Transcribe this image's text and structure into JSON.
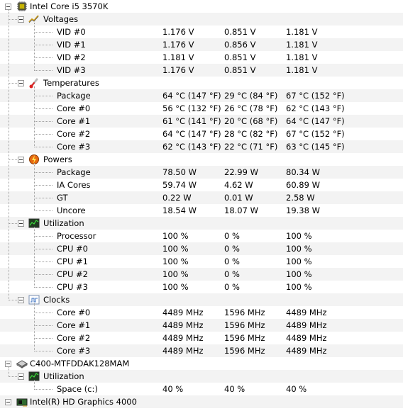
{
  "tree": {
    "cpu": {
      "name": "Intel Core i5 3570K",
      "groups": [
        {
          "title": "Voltages",
          "icon": "voltage-icon",
          "rows": [
            {
              "label": "VID #0",
              "value": "1.176 V",
              "min": "0.851 V",
              "max": "1.181 V"
            },
            {
              "label": "VID #1",
              "value": "1.176 V",
              "min": "0.856 V",
              "max": "1.181 V"
            },
            {
              "label": "VID #2",
              "value": "1.181 V",
              "min": "0.851 V",
              "max": "1.181 V"
            },
            {
              "label": "VID #3",
              "value": "1.176 V",
              "min": "0.851 V",
              "max": "1.181 V"
            }
          ]
        },
        {
          "title": "Temperatures",
          "icon": "thermometer-icon",
          "rows": [
            {
              "label": "Package",
              "value": "64 °C  (147 °F)",
              "min": "29 °C  (84 °F)",
              "max": "67 °C  (152 °F)"
            },
            {
              "label": "Core #0",
              "value": "56 °C  (132 °F)",
              "min": "26 °C  (78 °F)",
              "max": "62 °C  (143 °F)"
            },
            {
              "label": "Core #1",
              "value": "61 °C  (141 °F)",
              "min": "20 °C  (68 °F)",
              "max": "64 °C  (147 °F)"
            },
            {
              "label": "Core #2",
              "value": "64 °C  (147 °F)",
              "min": "28 °C  (82 °F)",
              "max": "67 °C  (152 °F)"
            },
            {
              "label": "Core #3",
              "value": "62 °C  (143 °F)",
              "min": "22 °C  (71 °F)",
              "max": "63 °C  (145 °F)"
            }
          ]
        },
        {
          "title": "Powers",
          "icon": "power-icon",
          "rows": [
            {
              "label": "Package",
              "value": "78.50 W",
              "min": "22.99 W",
              "max": "80.34 W"
            },
            {
              "label": "IA Cores",
              "value": "59.74 W",
              "min": "4.62 W",
              "max": "60.89 W"
            },
            {
              "label": "GT",
              "value": "0.22 W",
              "min": "0.01 W",
              "max": "2.58 W"
            },
            {
              "label": "Uncore",
              "value": "18.54 W",
              "min": "18.07 W",
              "max": "19.38 W"
            }
          ]
        },
        {
          "title": "Utilization",
          "icon": "utilization-icon",
          "rows": [
            {
              "label": "Processor",
              "value": "100 %",
              "min": "0 %",
              "max": "100 %"
            },
            {
              "label": "CPU #0",
              "value": "100 %",
              "min": "0 %",
              "max": "100 %"
            },
            {
              "label": "CPU #1",
              "value": "100 %",
              "min": "0 %",
              "max": "100 %"
            },
            {
              "label": "CPU #2",
              "value": "100 %",
              "min": "0 %",
              "max": "100 %"
            },
            {
              "label": "CPU #3",
              "value": "100 %",
              "min": "0 %",
              "max": "100 %"
            }
          ]
        },
        {
          "title": "Clocks",
          "icon": "clock-icon",
          "rows": [
            {
              "label": "Core #0",
              "value": "4489 MHz",
              "min": "1596 MHz",
              "max": "4489 MHz"
            },
            {
              "label": "Core #1",
              "value": "4489 MHz",
              "min": "1596 MHz",
              "max": "4489 MHz"
            },
            {
              "label": "Core #2",
              "value": "4489 MHz",
              "min": "1596 MHz",
              "max": "4489 MHz"
            },
            {
              "label": "Core #3",
              "value": "4489 MHz",
              "min": "1596 MHz",
              "max": "4489 MHz"
            }
          ]
        }
      ]
    },
    "disk": {
      "name": "C400-MTFDDAK128MAM",
      "groups": [
        {
          "title": "Utilization",
          "icon": "utilization-icon",
          "rows": [
            {
              "label": "Space (c:)",
              "value": "40 %",
              "min": "40 %",
              "max": "40 %"
            }
          ]
        }
      ]
    },
    "gpu": {
      "name": "Intel(R) HD Graphics 4000"
    }
  },
  "colors": {
    "alt_row": "#f3f3f3",
    "tree_line": "#a0a0a0"
  }
}
